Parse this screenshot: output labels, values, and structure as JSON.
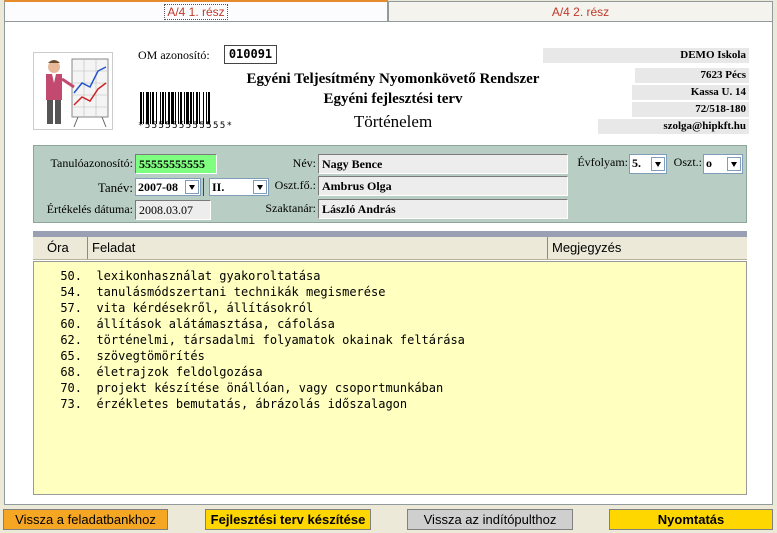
{
  "tabs": [
    {
      "label": "A/4 1. rész",
      "active": true
    },
    {
      "label": "A/4 2. rész",
      "active": false
    }
  ],
  "header": {
    "om_label": "OM azonosító:",
    "om_value": "010091",
    "barcode_text": "*555555555555*",
    "title_line1": "Egyéni Teljesítmény Nyomonkövető Rendszer",
    "title_line2": "Egyéni fejlesztési terv",
    "subject": "Történelem"
  },
  "school": {
    "name": "DEMO Iskola",
    "city": "7623 Pécs",
    "street": "Kassa U. 14",
    "phone": "72/518-180",
    "email": "szolga@hipkft.hu"
  },
  "student": {
    "id_label": "Tanulóazonosító:",
    "id_value": "55555555555",
    "year_label": "Tanév:",
    "year_value": "2007-08",
    "term_value": "II.",
    "eval_label": "Értékelés dátuma:",
    "eval_value": "2008.03.07",
    "name_label": "Név:",
    "name_value": "Nagy Bence",
    "head_label": "Oszt.fő.:",
    "head_value": "Ambrus Olga",
    "teacher_label": "Szaktanár:",
    "teacher_value": "László András",
    "grade_label": "Évfolyam:",
    "grade_value": "5.",
    "class_label": "Oszt.:",
    "class_value": "o"
  },
  "table": {
    "columns": [
      "Óra",
      "Feladat",
      "Megjegyzés"
    ],
    "rows": [
      {
        "num": "50.",
        "task": "lexikonhasználat gyakoroltatása"
      },
      {
        "num": "54.",
        "task": "tanulásmódszertani technikák megismerése"
      },
      {
        "num": "57.",
        "task": "vita kérdésekről, állításokról"
      },
      {
        "num": "60.",
        "task": "állítások alátámasztása, cáfolása"
      },
      {
        "num": "62.",
        "task": "történelmi, társadalmi folyamatok okainak feltárása"
      },
      {
        "num": "65.",
        "task": "szövegtömörítés"
      },
      {
        "num": "68.",
        "task": "életrajzok feldolgozása"
      },
      {
        "num": "70.",
        "task": "projekt készítése önállóan, vagy csoportmunkában"
      },
      {
        "num": "73.",
        "task": "érzékletes bemutatás, ábrázolás időszalagon"
      }
    ]
  },
  "buttons": {
    "back_bank": "Vissza a feladatbankhoz",
    "create_plan": "Fejlesztési terv készítése",
    "back_start": "Vissza az indítópulthoz",
    "print": "Nyomtatás"
  },
  "colors": {
    "orange": "#f5a623",
    "yellow": "#ffd700",
    "gray_btn": "#cfcfcf",
    "tab_text": "#c0392b"
  },
  "icons": {
    "presenter": "presenter-chart-icon",
    "barcode": "barcode-icon"
  }
}
